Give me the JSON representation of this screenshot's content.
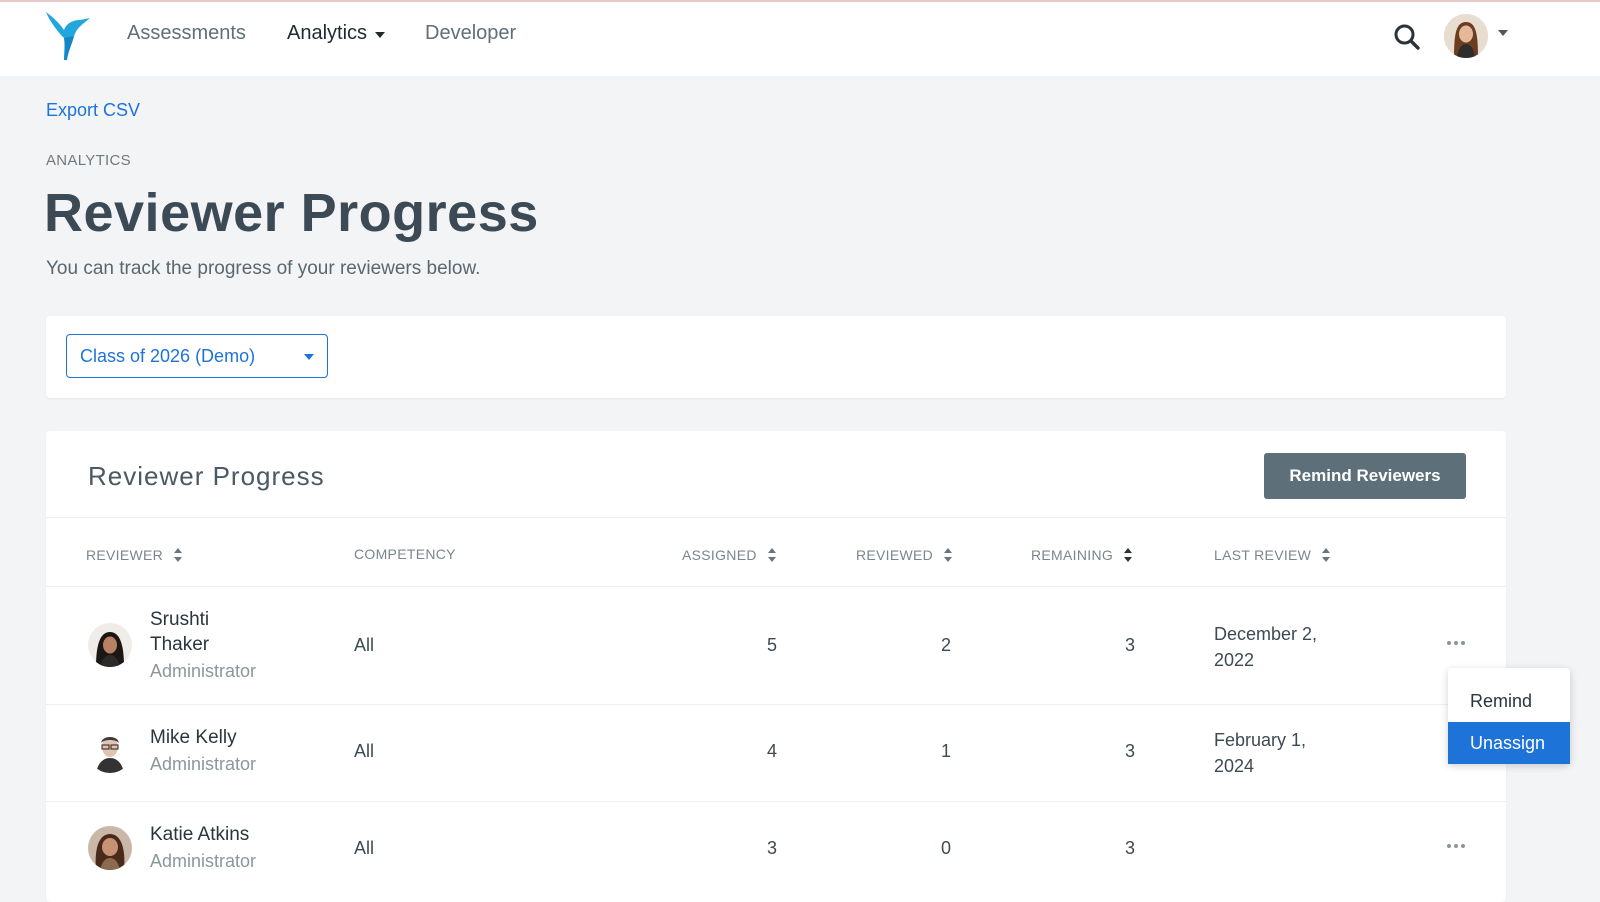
{
  "nav": {
    "items": [
      {
        "label": "Assessments"
      },
      {
        "label": "Analytics"
      },
      {
        "label": "Developer"
      }
    ]
  },
  "export_label": "Export CSV",
  "section_label": "ANALYTICS",
  "page_title": "Reviewer Progress",
  "page_subtitle": "You can track the progress of your reviewers below.",
  "filter": {
    "selected": "Class of 2026 (Demo)"
  },
  "card": {
    "title": "Reviewer Progress",
    "remind_button": "Remind Reviewers"
  },
  "table": {
    "headers": [
      "REVIEWER",
      "COMPETENCY",
      "ASSIGNED",
      "REVIEWED",
      "REMAINING",
      "LAST REVIEW"
    ],
    "rows": [
      {
        "first": "Srushti",
        "last": "Thaker",
        "role": "Administrator",
        "competency": "All",
        "assigned": "5",
        "reviewed": "2",
        "remaining": "3",
        "date_line1": "December 2,",
        "date_line2": "2022"
      },
      {
        "name": "Mike Kelly",
        "role": "Administrator",
        "competency": "All",
        "assigned": "4",
        "reviewed": "1",
        "remaining": "3",
        "date_line1": "February 1,",
        "date_line2": "2024"
      },
      {
        "name": "Katie Atkins",
        "role": "Administrator",
        "competency": "All",
        "assigned": "3",
        "reviewed": "0",
        "remaining": "3",
        "date_line1": "",
        "date_line2": ""
      }
    ]
  },
  "row_menu": {
    "items": [
      "Remind",
      "Unassign"
    ],
    "selected": "Unassign"
  },
  "colors": {
    "accent": "#1e73d8",
    "button": "#5d6f78",
    "background": "#f3f4f6"
  },
  "icons": [
    "hummingbird-logo-icon",
    "search-icon",
    "sort-icon",
    "more-dots-icon",
    "caret-down-icon"
  ]
}
